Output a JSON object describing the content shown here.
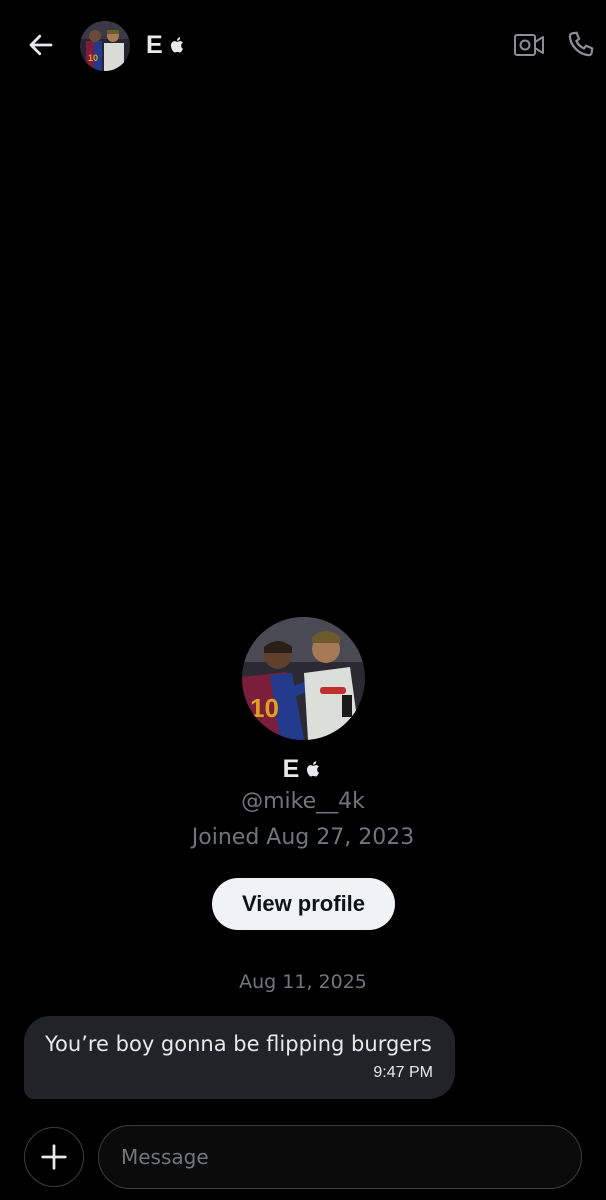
{
  "header": {
    "name": "E",
    "back_icon": "arrow-left-icon",
    "verified_icon": "apple-icon",
    "video_icon": "video-call-icon",
    "phone_icon": "phone-call-icon"
  },
  "profile": {
    "name": "E",
    "handle": "@mike__4k",
    "joined": "Joined Aug 27, 2023",
    "view_profile_label": "View profile"
  },
  "conversation": {
    "date": "Aug 11, 2025",
    "messages": [
      {
        "text": "You’re boy gonna be flipping burgers",
        "time": "9:47 PM"
      }
    ]
  },
  "composer": {
    "placeholder": "Message",
    "add_icon": "plus-icon"
  },
  "colors": {
    "background": "#000000",
    "bubble": "#202327",
    "muted_text": "#71767b",
    "primary_text": "#e7e9ea",
    "button_bg": "#eff3f4"
  }
}
